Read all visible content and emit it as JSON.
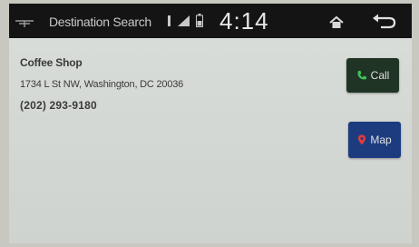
{
  "status_bar": {
    "title": "Destination Search",
    "clock": "4:14",
    "icons": [
      "antenna-icon",
      "bluetooth-icon",
      "signal-icon",
      "battery-icon",
      "home-icon",
      "back-icon"
    ]
  },
  "entry": {
    "name": "Coffee Shop",
    "address": "1734 L St NW, Washington, DC 20036",
    "phone": "(202) 293-9180"
  },
  "actions": {
    "call_label": "Call",
    "map_label": "Map"
  },
  "colors": {
    "status_bar_bg": "#141414",
    "content_bg": "#d4d8d4",
    "call_button": "#1f3424",
    "map_button": "#1d3c80"
  }
}
